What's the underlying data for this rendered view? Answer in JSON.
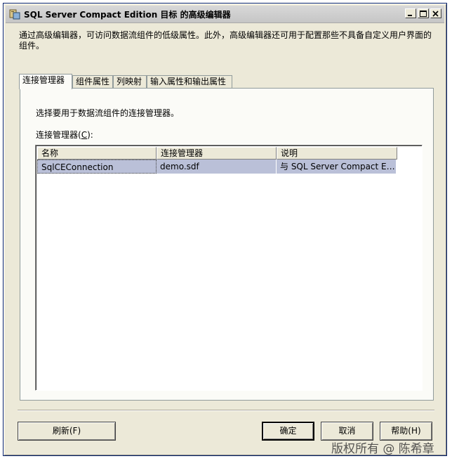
{
  "window": {
    "title": "SQL Server Compact Edition 目标 的高级编辑器"
  },
  "description": "通过高级编辑器，可访问数据流组件的低级属性。此外，高级编辑器还可用于配置那些不具备自定义用户界面的组件。",
  "tabs": [
    {
      "label": "连接管理器",
      "active": true
    },
    {
      "label": "组件属性",
      "active": false
    },
    {
      "label": "列映射",
      "active": false
    },
    {
      "label": "输入属性和输出属性",
      "active": false
    }
  ],
  "panel": {
    "instruction": "选择要用于数据流组件的连接管理器。",
    "connection_label_prefix": "连接管理器(",
    "connection_label_key": "C",
    "connection_label_suffix": "):",
    "columns": [
      "名称",
      "连接管理器",
      "说明"
    ],
    "rows": [
      {
        "name": "SqlCEConnection",
        "connection_manager": "demo.sdf",
        "description": "与 SQL Server Compact Editio..."
      }
    ]
  },
  "buttons": {
    "refresh": "刷新(F)",
    "ok": "确定",
    "cancel": "取消",
    "help": "帮助(H)"
  },
  "watermark": "版权所有 @ 陈希章"
}
